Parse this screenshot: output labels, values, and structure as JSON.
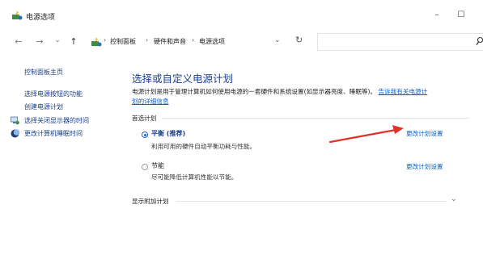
{
  "window": {
    "title": "电源选项",
    "minimize_glyph": "–",
    "maximize_glyph": "☐"
  },
  "nav": {
    "back_glyph": "←",
    "forward_glyph": "→",
    "recent_glyph": "⌄",
    "up_glyph": "↑",
    "breadcrumbs": [
      "控制面板",
      "硬件和声音",
      "电源选项"
    ],
    "separator": "›",
    "dropdown_glyph": "⌄",
    "refresh_glyph": "↻"
  },
  "sidebar": {
    "items": [
      {
        "label": "控制面板主页"
      },
      {
        "label": "选择电源按钮的功能"
      },
      {
        "label": "创建电源计划"
      },
      {
        "label": "选择关闭显示器的时间",
        "icon": "monitor-power-icon"
      },
      {
        "label": "更改计算机睡眠时间",
        "icon": "moon-sleep-icon"
      }
    ]
  },
  "main": {
    "heading": "选择或自定义电源计划",
    "description": "电源计划是用于管理计算机如何使用电源的一套硬件和系统设置(如显示器亮度、睡眠等)。",
    "description_link1": "告诉我有关电源计",
    "description_link2": "划的详细信息",
    "preferred_label": "首选计划",
    "plans": [
      {
        "name": "平衡 (推荐)",
        "desc": "利用可用的硬件自动平衡功耗与性能。",
        "link": "更改计划设置",
        "selected": true
      },
      {
        "name": "节能",
        "desc": "尽可能降低计算机性能以节能。",
        "link": "更改计划设置",
        "selected": false
      }
    ],
    "more_plans_label": "显示附加计划",
    "more_plans_glyph": "⌄"
  },
  "colors": {
    "link": "#0b60c8",
    "heading": "#1a3f8f",
    "annotation_arrow": "#e0312b"
  }
}
